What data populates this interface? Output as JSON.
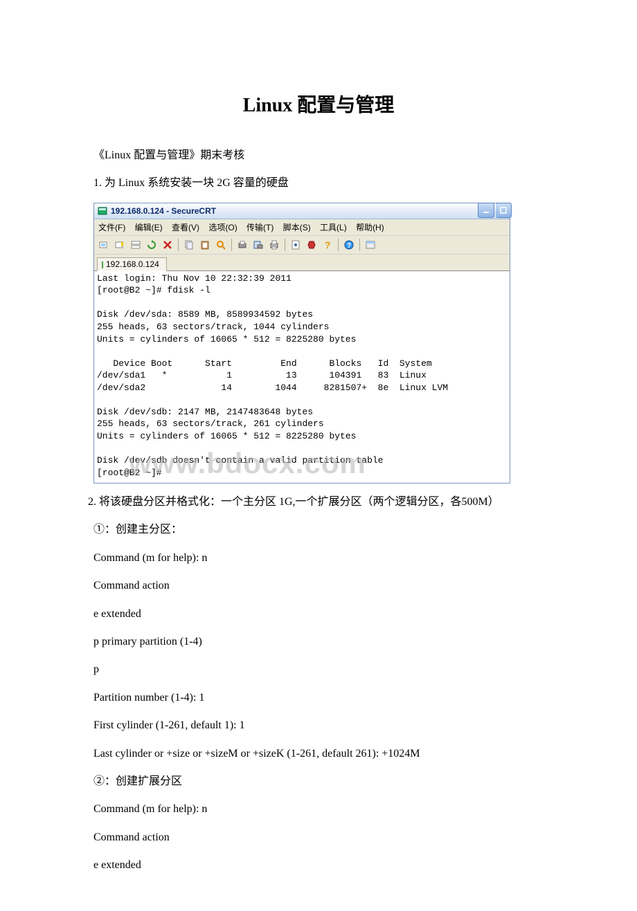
{
  "doc": {
    "title": "Linux 配置与管理",
    "subtitle": "《Linux 配置与管理》期末考核",
    "q1": "1. 为 Linux 系统安装一块 2G 容量的硬盘",
    "q2": "　　2. 将该硬盘分区并格式化：一个主分区 1G,一个扩展分区（两个逻辑分区，各500M）",
    "step1": "①：创建主分区：",
    "lines": {
      "l1": "Command (m for help): n",
      "l2": "Command action",
      "l3": " e extended",
      "l4": " p primary partition (1-4)",
      "l5": "p",
      "l6": "Partition number (1-4): 1",
      "l7": "First cylinder (1-261, default 1): 1",
      "l8": "Last cylinder or +size or +sizeM or +sizeK (1-261, default 261): +1024M"
    },
    "step2": "②：创建扩展分区",
    "lines2": {
      "l1": "Command (m for help): n",
      "l2": "Command action",
      "l3": " e extended"
    }
  },
  "crt": {
    "title": "192.168.0.124 - SecureCRT",
    "menus": [
      "文件(F)",
      "编辑(E)",
      "查看(V)",
      "选项(O)",
      "传输(T)",
      "脚本(S)",
      "工具(L)",
      "帮助(H)"
    ],
    "tab": "192.168.0.124",
    "terminal": "Last login: Thu Nov 10 22:32:39 2011\n[root@B2 ~]# fdisk -l\n\nDisk /dev/sda: 8589 MB, 8589934592 bytes\n255 heads, 63 sectors/track, 1044 cylinders\nUnits = cylinders of 16065 * 512 = 8225280 bytes\n\n   Device Boot      Start         End      Blocks   Id  System\n/dev/sda1   *           1          13      104391   83  Linux\n/dev/sda2              14        1044     8281507+  8e  Linux LVM\n\nDisk /dev/sdb: 2147 MB, 2147483648 bytes\n255 heads, 63 sectors/track, 261 cylinders\nUnits = cylinders of 16065 * 512 = 8225280 bytes\n\nDisk /dev/sdb doesn't contain a valid partition table\n[root@B2 ~]# ",
    "watermark": "www.bdocx.com"
  },
  "icons": {
    "app": "app-icon",
    "min": "minimize-icon",
    "max": "maximize-icon"
  }
}
